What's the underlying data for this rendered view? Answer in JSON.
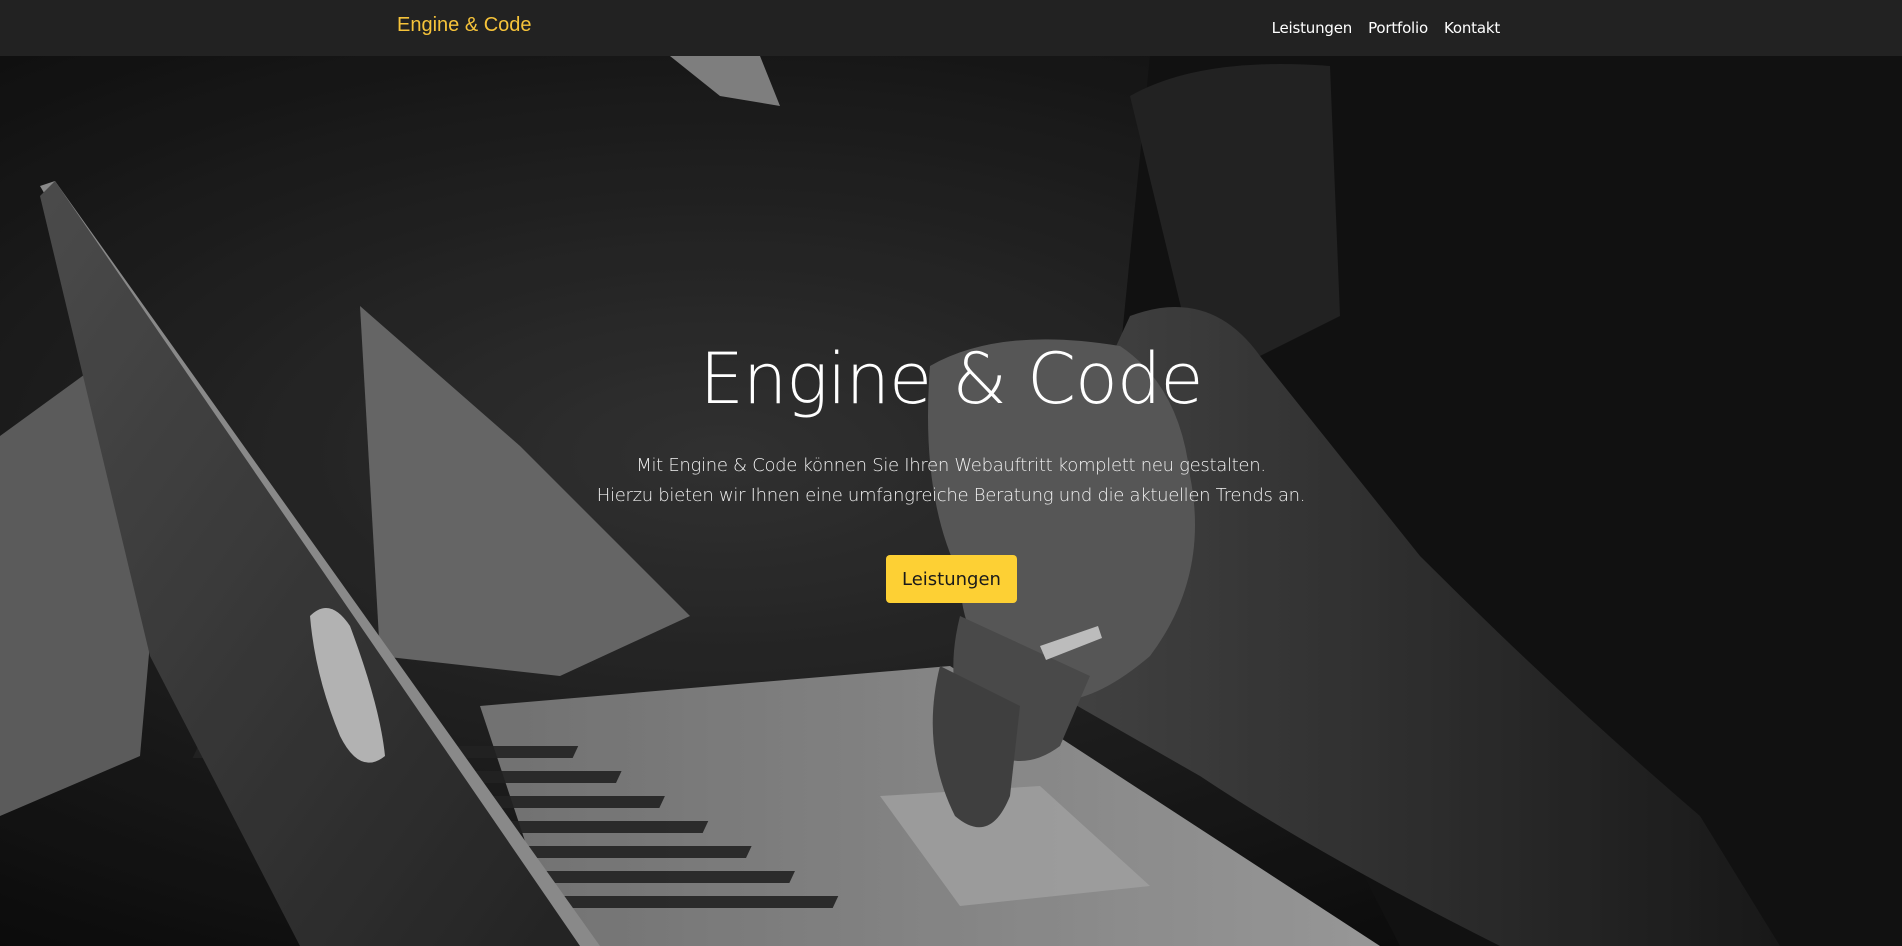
{
  "navbar": {
    "brand": "Engine & Code",
    "links": [
      "Leistungen",
      "Portfolio",
      "Kontakt"
    ]
  },
  "hero": {
    "title": "Engine & Code",
    "text_line1": "Mit Engine & Code können Sie Ihren Webauftritt komplett neu gestalten.",
    "text_line2": "Hierzu bieten wir Ihnen eine umfangreiche Beratung und die aktuellen Trends an.",
    "button_label": "Leistungen",
    "background_image": "laptop-typing-photo"
  },
  "colors": {
    "navbar_bg": "#222222",
    "brand": "#f6c33a",
    "button": "#fdd034"
  }
}
